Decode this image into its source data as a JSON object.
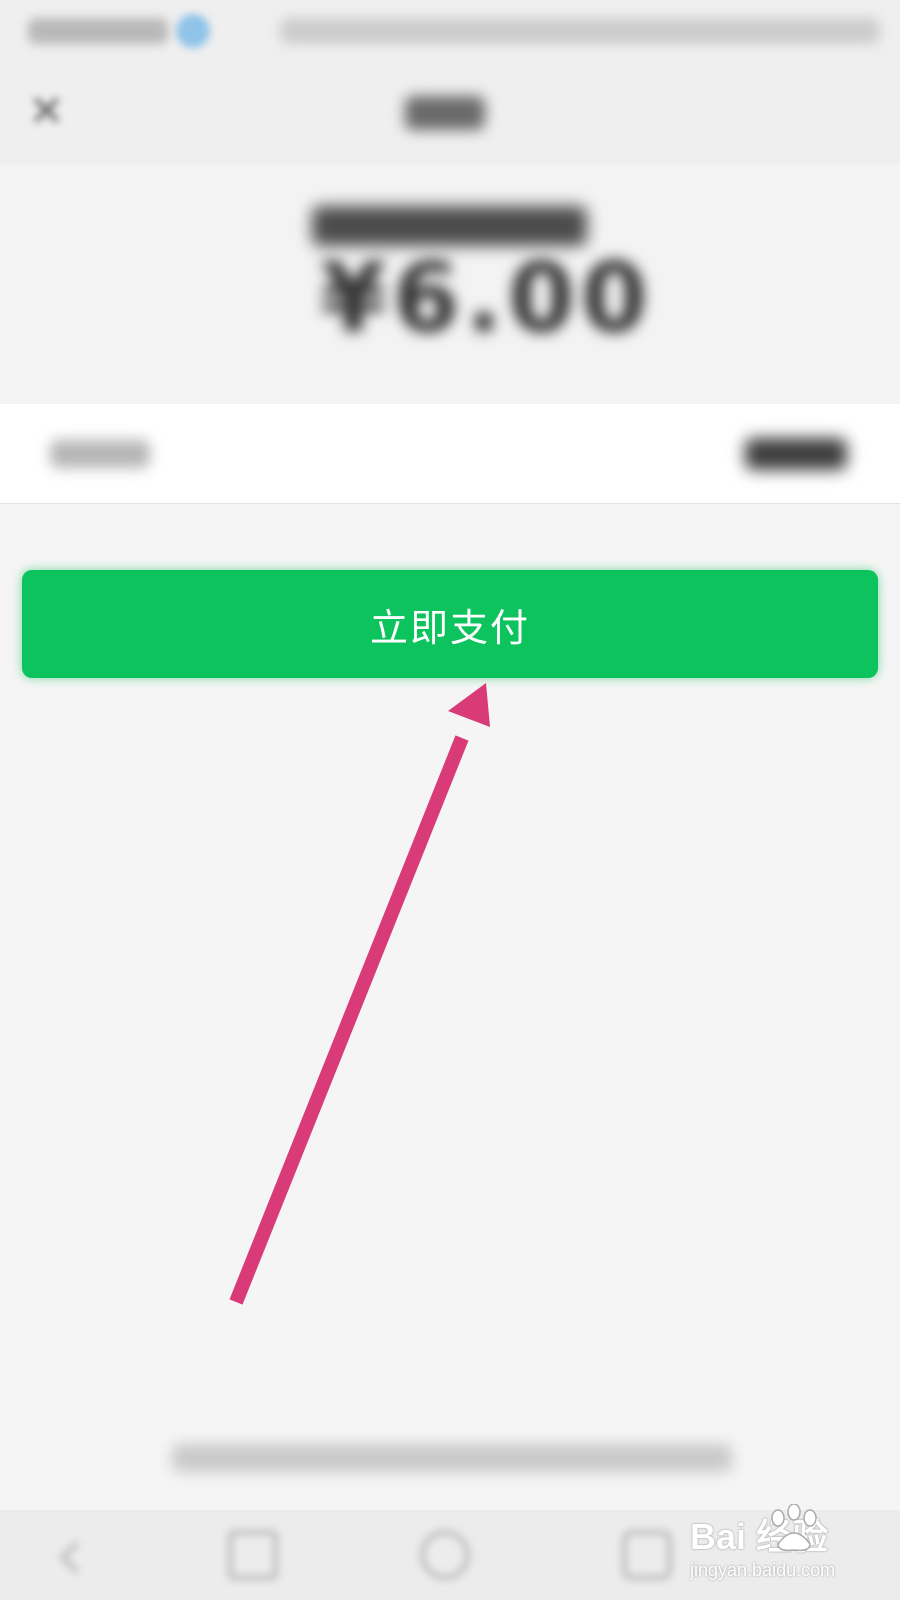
{
  "amount": {
    "value": "¥6.00"
  },
  "pay_button": {
    "label": "立即支付"
  },
  "watermark": {
    "brand": "Bai  经验",
    "site": "jingyan.baidu.com"
  },
  "colors": {
    "accent": "#0dc35d",
    "annotation": "#d93a78",
    "background": "#f5f5f5"
  }
}
